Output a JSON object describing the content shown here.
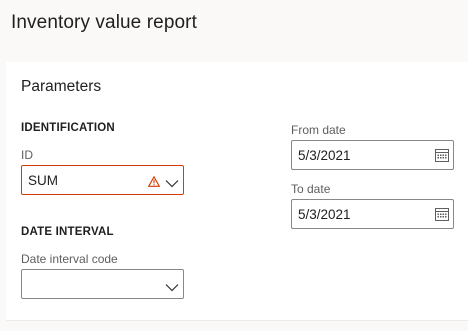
{
  "page": {
    "title": "Inventory value report"
  },
  "parameters": {
    "title": "Parameters",
    "identification": {
      "heading": "IDENTIFICATION",
      "id_label": "ID",
      "id_value": "SUM"
    },
    "date_interval": {
      "heading": "DATE INTERVAL",
      "code_label": "Date interval code",
      "code_value": ""
    },
    "from_date": {
      "label": "From date",
      "value": "5/3/2021"
    },
    "to_date": {
      "label": "To date",
      "value": "5/3/2021"
    }
  },
  "colors": {
    "error": "#d83b01",
    "border": "#8a8886"
  },
  "icons": [
    "warning-icon",
    "chevron-down-icon",
    "calendar-icon"
  ]
}
